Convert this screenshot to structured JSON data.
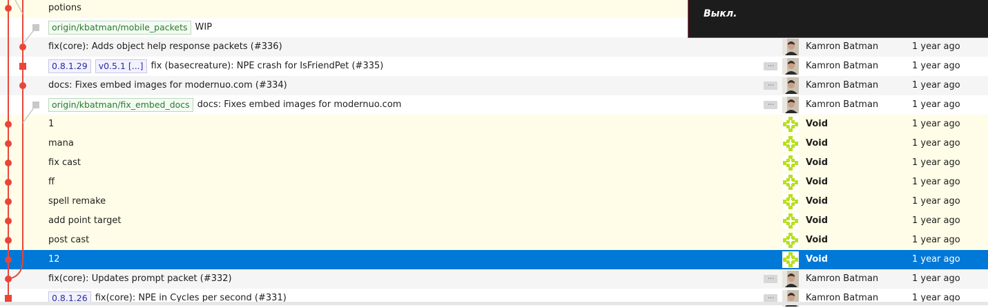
{
  "overlay": {
    "text": "Выкл."
  },
  "colors": {
    "selected": "#0078d7",
    "highlight_row": "#fffde7",
    "alt_row": "#f5f5f5",
    "graph_red": "#e8463a",
    "graph_gray": "#c8c8c8"
  },
  "commits": [
    {
      "refs": [],
      "message": "potions",
      "author": "",
      "author_bold": false,
      "date": "",
      "avatar": "",
      "more": false,
      "style": "highlight"
    },
    {
      "refs": [
        {
          "label": "origin/kbatman/mobile_packets",
          "kind": "branch"
        }
      ],
      "message": "WIP",
      "author": "",
      "author_bold": false,
      "date": "",
      "avatar": "",
      "more": false,
      "style": "plain"
    },
    {
      "refs": [],
      "message": "fix(core): Adds object help response packets (#336)",
      "author": "Kamron Batman",
      "author_bold": false,
      "date": "1 year ago",
      "avatar": "photo",
      "more": false,
      "style": "alt"
    },
    {
      "refs": [
        {
          "label": "0.8.1.29",
          "kind": "tag"
        },
        {
          "label": "v0.5.1 [...]",
          "kind": "tag"
        }
      ],
      "message": "fix (basecreature): NPE crash for IsFriendPet (#335)",
      "author": "Kamron Batman",
      "author_bold": false,
      "date": "1 year ago",
      "avatar": "photo",
      "more": true,
      "style": "plain"
    },
    {
      "refs": [],
      "message": "docs: Fixes embed images for modernuo.com (#334)",
      "author": "Kamron Batman",
      "author_bold": false,
      "date": "1 year ago",
      "avatar": "photo",
      "more": true,
      "style": "alt"
    },
    {
      "refs": [
        {
          "label": "origin/kbatman/fix_embed_docs",
          "kind": "branch"
        }
      ],
      "message": "docs: Fixes embed images for modernuo.com",
      "author": "Kamron Batman",
      "author_bold": false,
      "date": "1 year ago",
      "avatar": "photo",
      "more": true,
      "style": "plain"
    },
    {
      "refs": [],
      "message": "1",
      "author": "Void",
      "author_bold": true,
      "date": "1 year ago",
      "avatar": "identicon",
      "more": false,
      "style": "highlight"
    },
    {
      "refs": [],
      "message": "mana",
      "author": "Void",
      "author_bold": true,
      "date": "1 year ago",
      "avatar": "identicon",
      "more": false,
      "style": "highlight"
    },
    {
      "refs": [],
      "message": "fix cast",
      "author": "Void",
      "author_bold": true,
      "date": "1 year ago",
      "avatar": "identicon",
      "more": false,
      "style": "highlight"
    },
    {
      "refs": [],
      "message": "ff",
      "author": "Void",
      "author_bold": true,
      "date": "1 year ago",
      "avatar": "identicon",
      "more": false,
      "style": "highlight"
    },
    {
      "refs": [],
      "message": "spell remake",
      "author": "Void",
      "author_bold": true,
      "date": "1 year ago",
      "avatar": "identicon",
      "more": false,
      "style": "highlight"
    },
    {
      "refs": [],
      "message": "add point target",
      "author": "Void",
      "author_bold": true,
      "date": "1 year ago",
      "avatar": "identicon",
      "more": false,
      "style": "highlight"
    },
    {
      "refs": [],
      "message": "post cast",
      "author": "Void",
      "author_bold": true,
      "date": "1 year ago",
      "avatar": "identicon",
      "more": false,
      "style": "highlight"
    },
    {
      "refs": [],
      "message": "12",
      "author": "Void",
      "author_bold": true,
      "date": "1 year ago",
      "avatar": "identicon",
      "more": false,
      "style": "selected"
    },
    {
      "refs": [],
      "message": "fix(core): Updates prompt packet (#332)",
      "author": "Kamron Batman",
      "author_bold": false,
      "date": "1 year ago",
      "avatar": "photo",
      "more": true,
      "style": "alt"
    },
    {
      "refs": [
        {
          "label": "0.8.1.26",
          "kind": "tag"
        }
      ],
      "message": "fix(core): NPE in Cycles per second (#331)",
      "author": "Kamron Batman",
      "author_bold": false,
      "date": "1 year ago",
      "avatar": "photo",
      "more": true,
      "style": "plain"
    }
  ]
}
